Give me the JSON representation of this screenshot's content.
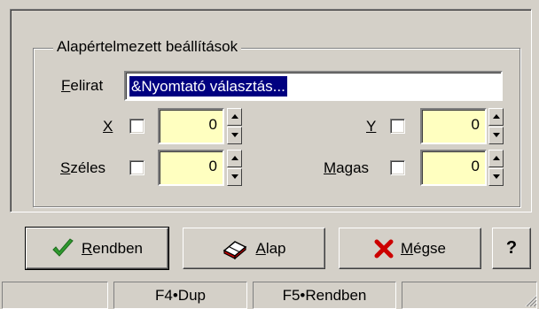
{
  "group": {
    "title": "Alapértelmezett beállítások"
  },
  "caption": {
    "label_underline": "F",
    "label_rest": "elirat",
    "value": "&Nyomtató választás..."
  },
  "x": {
    "label": "X",
    "value": "0"
  },
  "y": {
    "label": "Y",
    "value": "0"
  },
  "width": {
    "label_underline": "S",
    "label_rest": "zéles",
    "value": "0"
  },
  "height": {
    "label_underline": "M",
    "label_rest": "agas",
    "value": "0"
  },
  "buttons": {
    "ok": {
      "underline": "R",
      "rest": "endben"
    },
    "default": {
      "underline": "A",
      "rest": "lap"
    },
    "cancel": {
      "underline": "M",
      "rest": "égse"
    },
    "help": "?"
  },
  "statusbar": {
    "cell2": "F4•Dup",
    "cell3": "F5•Rendben"
  },
  "colors": {
    "face": "#d4d0c8",
    "numfield": "#ffffc0",
    "selection": "#000080",
    "ok_check": "#2f9a2f",
    "cancel_x": "#cc0000"
  }
}
